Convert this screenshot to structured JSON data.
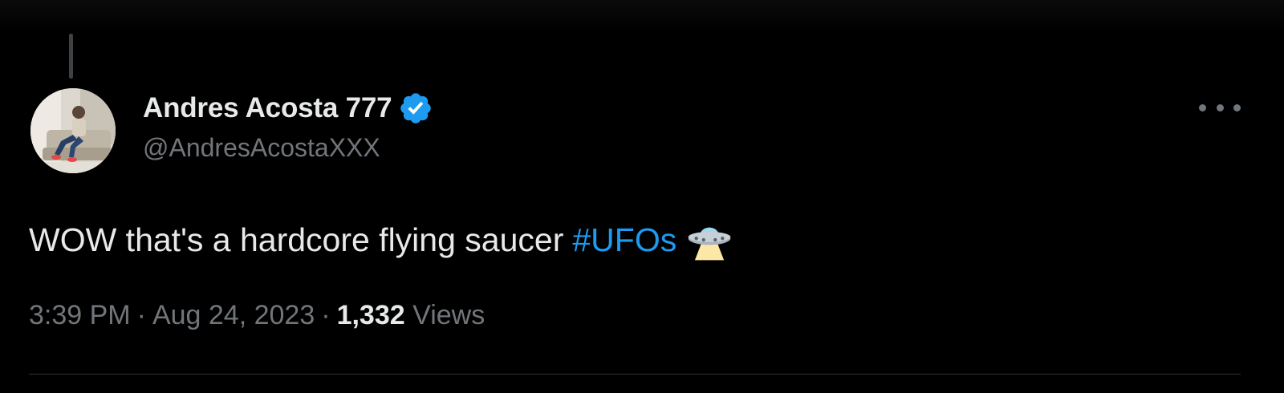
{
  "tweet": {
    "author": {
      "display_name": "Andres Acosta 777",
      "handle": "@AndresAcostaXXX",
      "verified": true
    },
    "text": "WOW that's a hardcore flying saucer",
    "hashtag": "#UFOs",
    "emoji_icon": "flying-saucer-icon",
    "time": "3:39 PM",
    "date": "Aug 24, 2023",
    "separator": "·",
    "views_count": "1,332",
    "views_label": "Views"
  },
  "colors": {
    "background": "#000000",
    "primary_text": "#e7e9ea",
    "secondary_text": "#71767b",
    "link": "#1d9bf0",
    "verified_badge": "#1d9bf0",
    "divider": "#2f3336"
  }
}
